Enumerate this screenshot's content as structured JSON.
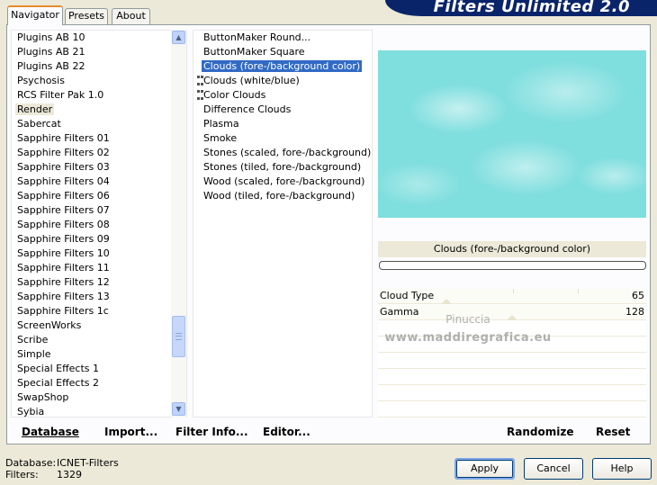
{
  "header": {
    "title": "Filters Unlimited 2.0"
  },
  "tabs": [
    {
      "label": "Navigator",
      "active": true
    },
    {
      "label": "Presets",
      "active": false
    },
    {
      "label": "About",
      "active": false
    }
  ],
  "categories": {
    "items": [
      "Plugins AB 10",
      "Plugins AB 21",
      "Plugins AB 22",
      "Psychosis",
      "RCS Filter Pak 1.0",
      "Render",
      "Sabercat",
      "Sapphire Filters 01",
      "Sapphire Filters 02",
      "Sapphire Filters 03",
      "Sapphire Filters 04",
      "Sapphire Filters 06",
      "Sapphire Filters 07",
      "Sapphire Filters 08",
      "Sapphire Filters 09",
      "Sapphire Filters 10",
      "Sapphire Filters 11",
      "Sapphire Filters 12",
      "Sapphire Filters 13",
      "Sapphire Filters 1c",
      "ScreenWorks",
      "Scribe",
      "Simple",
      "Special Effects 1",
      "Special Effects 2",
      "SwapShop",
      "Sybia"
    ],
    "selected": "Render"
  },
  "filters": {
    "items": [
      "ButtonMaker Round...",
      "ButtonMaker Square",
      "Clouds (fore-/background color)",
      "Clouds (white/blue)",
      "Color Clouds",
      "Difference Clouds",
      "Plasma",
      "Smoke",
      "Stones (scaled, fore-/background)",
      "Stones (tiled, fore-/background)",
      "Wood (scaled, fore-/background)",
      "Wood (tiled, fore-/background)"
    ],
    "selected": "Clouds (fore-/background color)"
  },
  "preview": {
    "filter_name": "Clouds (fore-/background color)"
  },
  "params": [
    {
      "name": "Cloud Type",
      "value": "65"
    },
    {
      "name": "Gamma",
      "value": "128"
    }
  ],
  "watermark": {
    "line1": "Pinuccia",
    "line2": "www.maddiregrafica.eu"
  },
  "toolbar": {
    "database": "Database",
    "import": "Import...",
    "filter_info": "Filter Info...",
    "editor": "Editor...",
    "randomize": "Randomize",
    "reset": "Reset"
  },
  "footer": {
    "database_label": "Database:",
    "database_value": "ICNET-Filters",
    "filters_label": "Filters:",
    "filters_value": "1329"
  },
  "buttons": {
    "apply": "Apply",
    "cancel": "Cancel",
    "help": "Help"
  },
  "colors": {
    "dialog_bg": "#ece9d8",
    "banner_bg": "#0a246a",
    "selection": "#316ac5",
    "preview_cyan": "#7fdede"
  }
}
